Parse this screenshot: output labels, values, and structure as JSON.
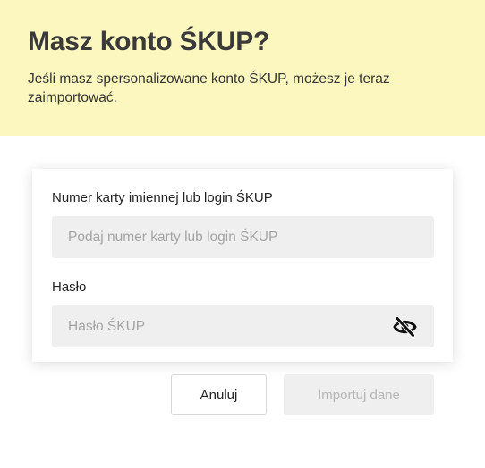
{
  "header": {
    "title": "Masz konto ŚKUP?",
    "description": "Jeśli masz spersonalizowane konto ŚKUP, możesz je teraz zaimportować."
  },
  "form": {
    "login_label": "Numer karty imiennej lub login ŚKUP",
    "login_placeholder": "Podaj numer karty lub login ŚKUP",
    "login_value": "",
    "password_label": "Hasło",
    "password_placeholder": "Hasło ŚKUP",
    "password_value": "",
    "password_visibility_icon": "eye-slash-icon"
  },
  "actions": {
    "cancel_label": "Anuluj",
    "import_label": "Importuj dane"
  },
  "colors": {
    "banner_background": "#fcf7bf",
    "input_background": "#efefef",
    "disabled_button_background": "#efefef",
    "disabled_button_text": "#b5b5b5"
  }
}
